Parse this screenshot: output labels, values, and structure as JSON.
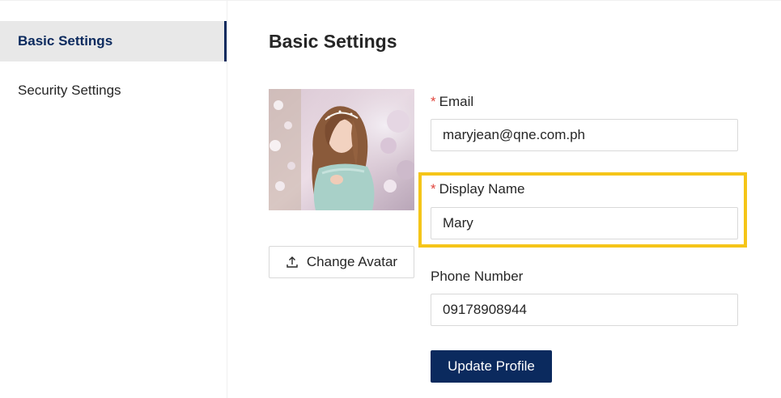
{
  "sidebar": {
    "items": [
      {
        "label": "Basic Settings",
        "active": true
      },
      {
        "label": "Security Settings",
        "active": false
      }
    ],
    "accent_color": "#0b2a5e"
  },
  "main": {
    "title": "Basic Settings",
    "avatar": {
      "icon": "profile-photo"
    },
    "change_avatar": {
      "label": "Change Avatar",
      "icon": "upload-icon"
    },
    "form": {
      "email": {
        "label": "Email",
        "required": "*",
        "value": "maryjean@qne.com.ph"
      },
      "display_name": {
        "label": "Display Name",
        "required": "*",
        "value": "Mary"
      },
      "phone": {
        "label": "Phone Number",
        "value": "09178908944"
      },
      "submit_label": "Update Profile"
    },
    "highlight_color": "#f5c518",
    "required_color": "#e0443c"
  }
}
